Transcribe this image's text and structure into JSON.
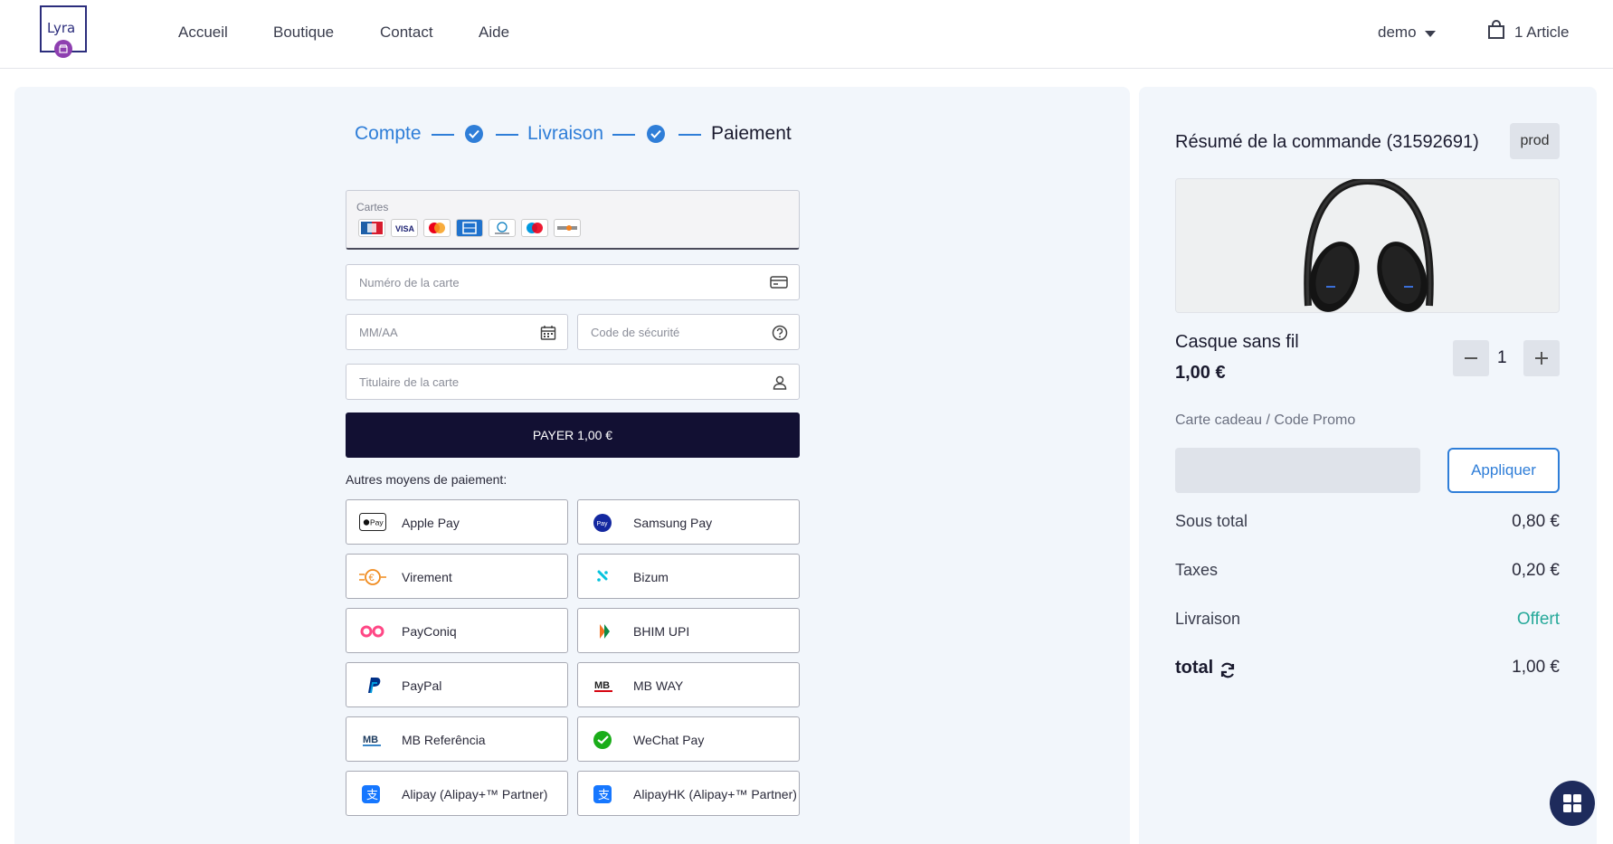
{
  "header": {
    "logo_text": "Lyra",
    "nav": [
      "Accueil",
      "Boutique",
      "Contact",
      "Aide"
    ],
    "user": "demo",
    "cart_label": "1 Article"
  },
  "stepper": {
    "step1": "Compte",
    "step2": "Livraison",
    "step3": "Paiement"
  },
  "payment_form": {
    "cards_label": "Cartes",
    "card_brands": [
      "cb-icon",
      "visa-icon",
      "mastercard-icon",
      "amex-icon",
      "diners-icon",
      "maestro-icon",
      "discover-icon"
    ],
    "card_number_placeholder": "Numéro de la carte",
    "expiry_placeholder": "MM/AA",
    "cvv_placeholder": "Code de sécurité",
    "holder_placeholder": "Titulaire de la carte",
    "pay_button": "PAYER 1,00 €",
    "other_methods_label": "Autres moyens de paiement:",
    "methods": [
      {
        "label": "Apple Pay",
        "icon": "apple-pay-icon"
      },
      {
        "label": "Samsung Pay",
        "icon": "samsung-pay-icon"
      },
      {
        "label": "Virement",
        "icon": "transfer-icon"
      },
      {
        "label": "Bizum",
        "icon": "bizum-icon"
      },
      {
        "label": "PayConiq",
        "icon": "payconiq-icon"
      },
      {
        "label": "BHIM UPI",
        "icon": "bhim-upi-icon"
      },
      {
        "label": "PayPal",
        "icon": "paypal-icon"
      },
      {
        "label": "MB WAY",
        "icon": "mbway-icon"
      },
      {
        "label": "MB Referência",
        "icon": "mb-referencia-icon"
      },
      {
        "label": "WeChat Pay",
        "icon": "wechat-pay-icon"
      },
      {
        "label": "Alipay (Alipay+™ Partner)",
        "icon": "alipay-icon"
      },
      {
        "label": "AlipayHK (Alipay+™ Partner)",
        "icon": "alipayhk-icon"
      }
    ]
  },
  "summary": {
    "title": "Résumé de la commande (31592691)",
    "env_badge": "prod",
    "product_name": "Casque sans fil",
    "product_price": "1,00 €",
    "quantity": "1",
    "promo_label": "Carte cadeau / Code Promo",
    "promo_value": "",
    "apply_button": "Appliquer",
    "subtotal_label": "Sous total",
    "subtotal_value": "0,80 €",
    "taxes_label": "Taxes",
    "taxes_value": "0,20 €",
    "shipping_label": "Livraison",
    "shipping_value": "Offert",
    "total_label": "total",
    "total_value": "1,00 €"
  },
  "colors": {
    "accent": "#2f7ed8",
    "pay_button": "#121033",
    "panel_bg": "#f2f6fb",
    "free_green": "#27a99a"
  }
}
